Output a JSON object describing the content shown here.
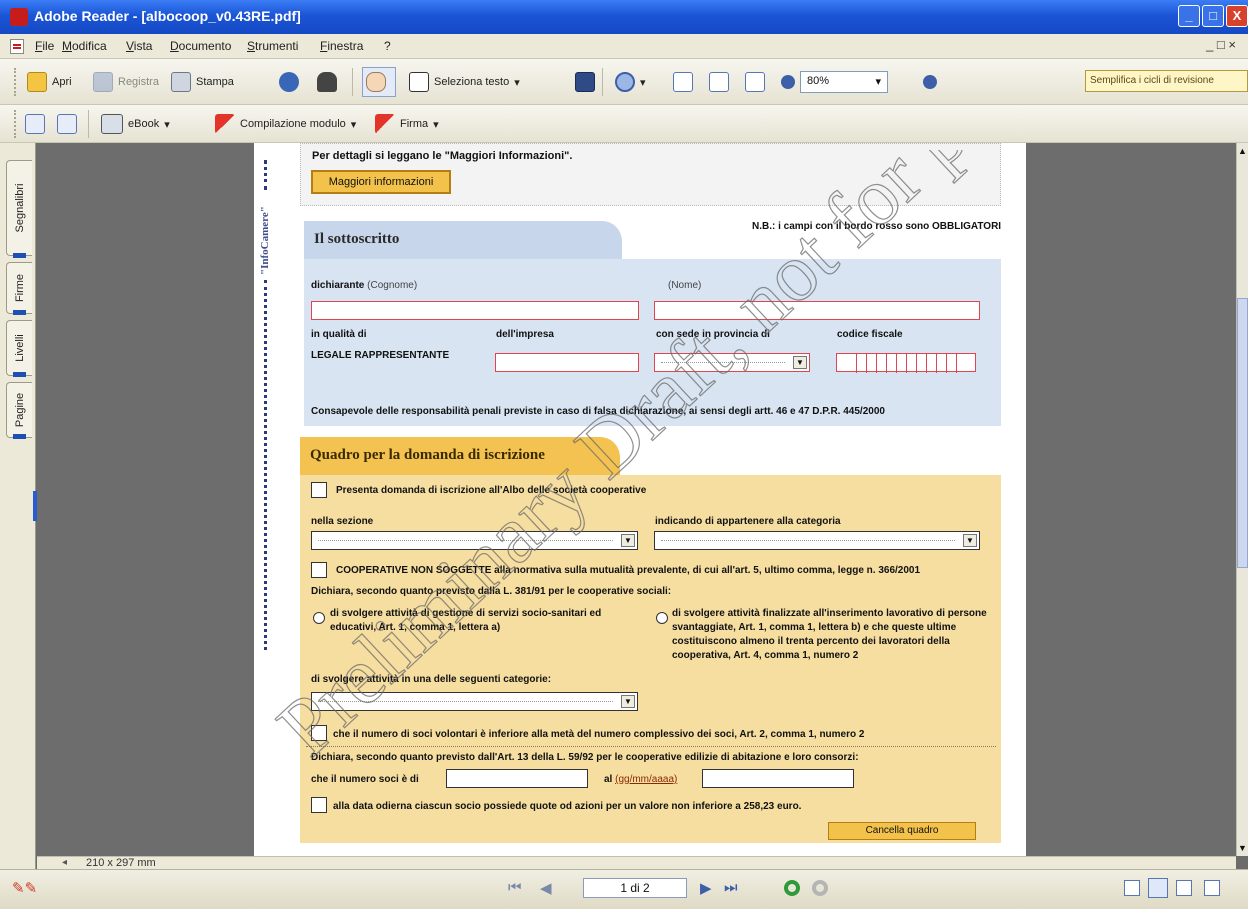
{
  "window": {
    "title": "Adobe Reader - [albocoop_v0.43RE.pdf]",
    "min": "_",
    "max": "□",
    "close": "X"
  },
  "menu": {
    "items": [
      "File",
      "Modifica",
      "Vista",
      "Documento",
      "Strumenti",
      "Finestra",
      "?"
    ],
    "right": "_ □ ×"
  },
  "toolbar1": {
    "open": "Apri",
    "save": "Registra",
    "print": "Stampa",
    "select_text": "Seleziona testo",
    "zoom": "80%",
    "search_placeholder": "Semplifica i cicli di revisione"
  },
  "toolbar2": {
    "ebook": "eBook",
    "form_fill": "Compilazione modulo",
    "sign": "Firma"
  },
  "navtabs": [
    "Segnalibri",
    "Firme",
    "Livelli",
    "Pagine"
  ],
  "status": {
    "page_size": "210 x 297 mm",
    "page_indicator": "1 di 2"
  },
  "form": {
    "brand": "\"InfoCamere\"",
    "info_text": "Per dettagli si leggano le \"Maggiori Informazioni\".",
    "info_button": "Maggiori informazioni",
    "required_note": "N.B.: i campi con il  bordo rosso  sono OBBLIGATORI",
    "section1": {
      "title": "Il sottoscritto",
      "declarant_label": "dichiarante",
      "surname_hint": "(Cognome)",
      "name_hint": "(Nome)",
      "capacity_label": "in qualità di",
      "company_label": "dell'impresa",
      "province_label": "con sede in provincia di",
      "fiscal_label": "codice fiscale",
      "capacity_value": "LEGALE RAPPRESENTANTE",
      "disclaimer": "Consapevole delle responsabilità penali previste in caso di falsa dichiarazione, ai sensi degli artt. 46 e 47 D.P.R. 445/2000"
    },
    "section2": {
      "title": "Quadro per la domanda di iscrizione",
      "check1": "Presenta domanda di iscrizione all'Albo delle società cooperative",
      "section_label": "nella sezione",
      "category_label": "indicando di appartenere alla categoria",
      "check2": "COOPERATIVE NON SOGGETTE alla normativa sulla mutualità prevalente, di cui all'art. 5, ultimo comma, legge n. 366/2001",
      "declare1": "Dichiara, secondo quanto previsto dalla L. 381/91 per le cooperative sociali:",
      "radio1": "di svolgere attività di gestione di servizi socio-sanitari ed educativi, Art. 1, comma 1, lettera a)",
      "radio2": "di svolgere attività finalizzate all'inserimento lavorativo di persone svantaggiate, Art. 1, comma 1, lettera b) e che queste ultime costituiscono almeno il trenta percento dei lavoratori della cooperativa, Art. 4, comma 1, numero 2",
      "activity_label": "di svolgere attività in una delle seguenti categorie:",
      "check3": "che il numero di soci volontari è inferiore alla metà del numero complessivo dei soci, Art. 2, comma 1, numero 2",
      "declare2": "Dichiara, secondo quanto previsto dall'Art. 13 della L. 59/92 per le cooperative edilizie di abitazione e loro consorzi:",
      "members_label": "che il numero soci è di",
      "date_label": "al",
      "date_hint": "(gg/mm/aaaa)",
      "check4": "alla data odierna ciascun socio possiede quote od azioni per un valore non inferiore a 258,23 euro.",
      "cancel_button": "Cancella quadro"
    },
    "watermark": "Preliminary Draft, not for p"
  }
}
